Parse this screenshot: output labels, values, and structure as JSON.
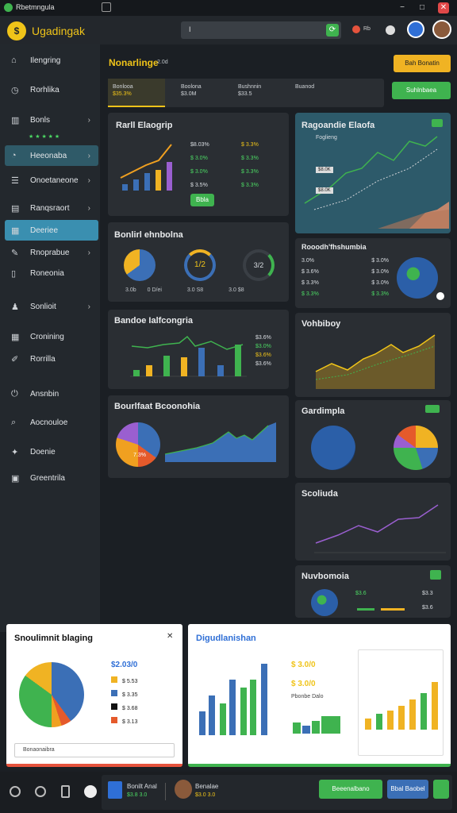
{
  "titlebar": {
    "title": "Rbetmngula"
  },
  "appbar": {
    "brand": "Ugadingak",
    "search_value": "I",
    "notif_label": "Rb"
  },
  "sidebar": {
    "items": [
      {
        "label": "Ilengring",
        "icon": "home-icon"
      },
      {
        "label": "Rorhlika",
        "icon": "clock-icon"
      },
      {
        "label": "Bonls",
        "icon": "chart-icon"
      },
      {
        "label": "Heeonaba",
        "icon": "gauge-icon"
      },
      {
        "label": "Onoetaneone",
        "icon": "list-icon"
      },
      {
        "label": "Ranqsraort",
        "icon": "report-icon"
      },
      {
        "label": "Deeriee",
        "icon": "calendar-icon"
      },
      {
        "label": "Rnoprabue",
        "icon": "edit-icon"
      },
      {
        "label": "Roneonia",
        "icon": "doc-icon"
      },
      {
        "label": "Sonlioit",
        "icon": "users-icon"
      },
      {
        "label": "Cronining",
        "icon": "grid-icon"
      },
      {
        "label": "Rorrilla",
        "icon": "pen-icon"
      },
      {
        "label": "Ansnbin",
        "icon": "power-icon"
      },
      {
        "label": "Aocnouloe",
        "icon": "search-icon"
      },
      {
        "label": "Doenie",
        "icon": "tag-icon"
      },
      {
        "label": "Greentrila",
        "icon": "box-icon"
      }
    ],
    "stars": "★ ★ ★ ★ ★"
  },
  "main": {
    "heading": "Nonarlinge",
    "heading_sub": "2.0d",
    "cta_label": "Bah Bonatin",
    "action_label": "Suhlnbaea",
    "tabs": [
      {
        "label": "Bonlooa",
        "value": "$35.3%"
      },
      {
        "label": "Boolona",
        "value": "$3.0M"
      },
      {
        "label": "Bushnnin",
        "value": "$33.5"
      },
      {
        "label": "Buanod",
        "value": ""
      }
    ],
    "card1": {
      "title": "Rarll Elaogrip",
      "values": [
        "$8.03%",
        "$ 3.0%",
        "$ 3.0%",
        "$ 3.5%"
      ],
      "deltas": [
        "$ 3.3%",
        "$ 3.3%",
        "$ 3.3%",
        "$ 3.3%"
      ],
      "btn": "Bbla"
    },
    "card2": {
      "title": "Bonlirl ehnbolna",
      "gauges": [
        "",
        "1/2",
        "3/2"
      ],
      "footer": [
        "3.0b",
        "0 D/ei",
        "3.0 S8",
        "3.0 $8"
      ]
    },
    "card3": {
      "title": "Bandoe Ialfcongria",
      "values": [
        "$3.6%",
        "$3.0%",
        "$3.6%",
        "$3.6%"
      ]
    },
    "card4": {
      "title": "Bourlfaat Bcoonohia",
      "pie_label": "7.3%"
    },
    "right1": {
      "title": "Ragoandie Elaofa",
      "labels": [
        "Foglieng",
        "$8.0K",
        "$8.0K"
      ]
    },
    "right2": {
      "title": "Rooodh'fhshumbia",
      "rows": [
        [
          "3.0%",
          "$ 3.0%"
        ],
        [
          "$ 3.6%",
          "$ 3.0%"
        ],
        [
          "$ 3.3%",
          "$ 3.0%"
        ],
        [
          "$ 3.3%",
          "$ 3.3%"
        ]
      ]
    },
    "right3": {
      "title": "Vohbiboy"
    },
    "right4": {
      "title": "Gardimpla"
    },
    "right5": {
      "title": "Scoliuda"
    },
    "right6": {
      "title": "Nuvbomoia",
      "values": [
        "$3.6",
        "$3.3",
        "$3.6"
      ]
    }
  },
  "popup1": {
    "title": "Snoulimnit blaging",
    "total": "$2.03/0",
    "items": [
      "$ 5.53",
      "$ 3.35",
      "$ 3.68",
      "$ 3.13"
    ],
    "footer": "Bonaonaibra"
  },
  "popup2": {
    "title": "Digudlanishan",
    "v1": "$ 3.0/0",
    "v2": "$ 3.0/0",
    "v3": "Pbonbe Dalo"
  },
  "bottom": {
    "user1": "Bonilt Anal",
    "user1_sub": "$3.8 3.0",
    "user2": "Benalae",
    "user2_sub": "$3.0 3.0",
    "btn1": "Beeenalbano",
    "btn2": "Bbal Baobel"
  },
  "colors": {
    "accent": "#f0c419",
    "green": "#3fb34f",
    "blue": "#3b6fb6",
    "bg": "#1b1f24"
  }
}
